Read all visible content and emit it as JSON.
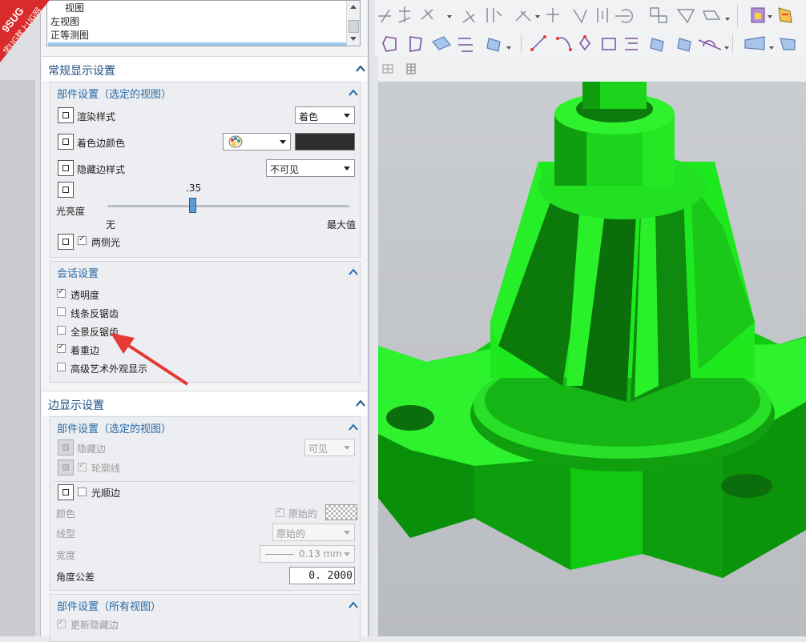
{
  "view_list": {
    "items": [
      "视图",
      "左视图",
      "正等测图"
    ]
  },
  "general_section": {
    "title": "常规显示设置",
    "part_group": {
      "title": "部件设置（选定的视图）",
      "render_style_label": "渲染样式",
      "render_style_value": "着色",
      "shaded_edge_color_label": "着色边颜色",
      "hidden_edge_style_label": "隐藏边样式",
      "hidden_edge_style_value": "不可见",
      "light_intensity_label": "光亮度",
      "slider_value_text": ".35",
      "slider_level": 0.35,
      "slider_min_label": "无",
      "slider_max_label": "最大值",
      "two_sided_light_label": "两侧光"
    },
    "session_group": {
      "title": "会话设置",
      "items": [
        {
          "label": "透明度",
          "checked": true
        },
        {
          "label": "线条反锯齿",
          "checked": false
        },
        {
          "label": "全景反锯齿",
          "checked": false
        },
        {
          "label": "着重边",
          "checked": true
        },
        {
          "label": "高级艺术外观显示",
          "checked": false
        }
      ]
    }
  },
  "edge_section": {
    "title": "边显示设置",
    "part_group": {
      "title": "部件设置（选定的视图）",
      "hidden_edge_label": "隐藏边",
      "hidden_edge_value": "可见",
      "silhouette_label": "轮廓线",
      "smooth_edge_label": "光顺边",
      "color_label": "颜色",
      "original_label": "原始的",
      "line_type_label": "线型",
      "line_type_value": "原始的",
      "width_label": "宽度",
      "width_value": "0.13 mm",
      "angle_tolerance_label": "角度公差",
      "angle_tolerance_value": "0. 2000"
    },
    "all_views_group": {
      "title": "部件设置（所有视图）",
      "update_hidden_edge_label": "更新隐藏边"
    }
  },
  "watermark": {
    "line1": "9SUG",
    "line2": "学UG就上UG网"
  },
  "colors": {
    "header_text": "#1d4f82",
    "group_title": "#2a6aa6",
    "model_green": "#1ee81e",
    "model_dark": "#0a8a0a",
    "arrow": "#e53935"
  }
}
